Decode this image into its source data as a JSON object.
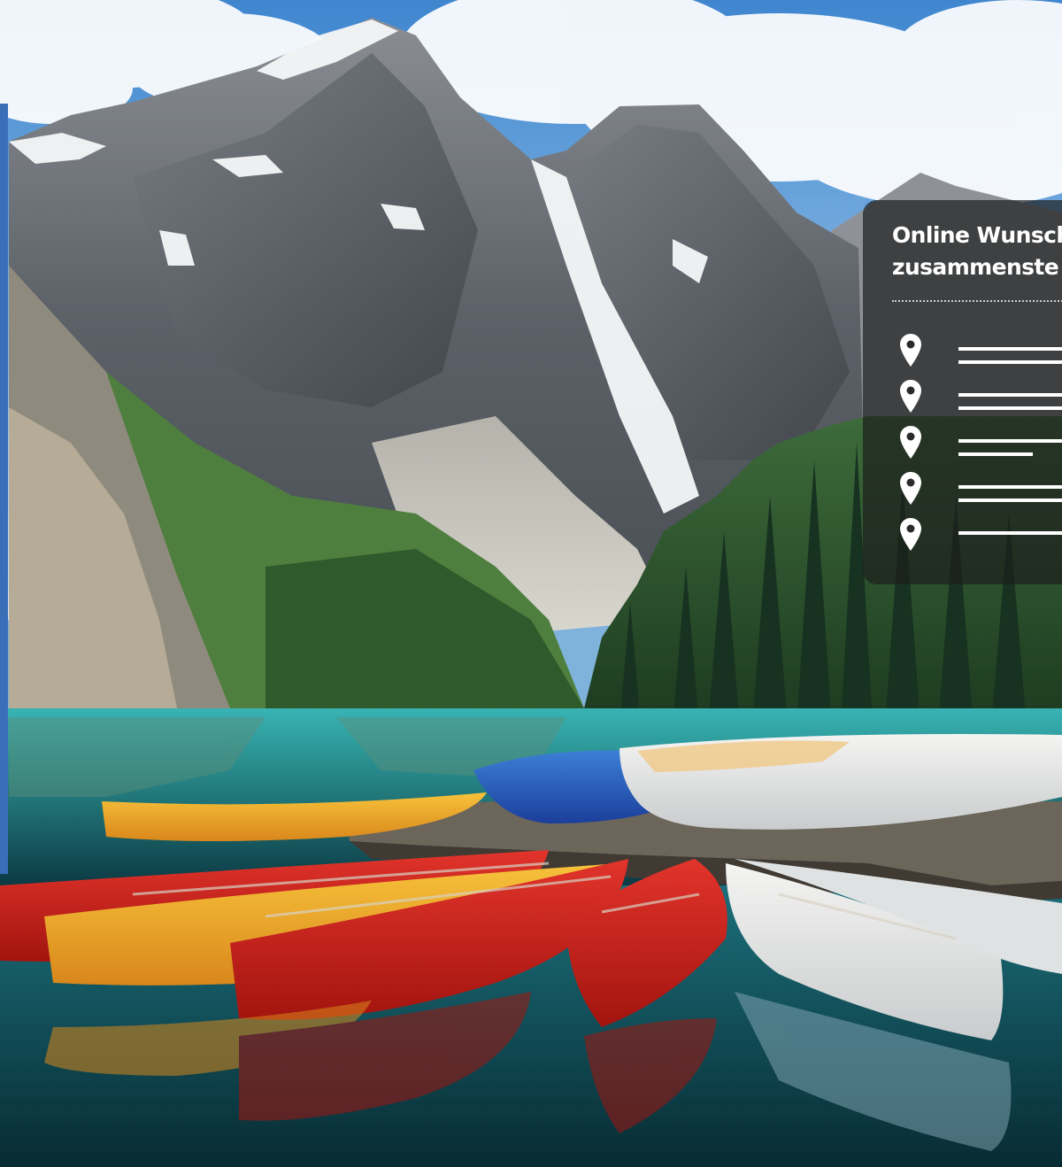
{
  "panel": {
    "title": "Online Wunsch\nzusammenste",
    "list": [
      {
        "icon": "map-pin-icon",
        "lines": 2
      },
      {
        "icon": "map-pin-icon",
        "lines": 2
      },
      {
        "icon": "map-pin-icon",
        "lines": 2,
        "short_second_line": true
      },
      {
        "icon": "map-pin-icon",
        "lines": 2
      },
      {
        "icon": "map-pin-icon",
        "lines": 1
      }
    ]
  },
  "colors": {
    "accent_strip": "#3a6fb8",
    "panel_bg": "#1c1e1c",
    "panel_text": "#ffffff"
  }
}
